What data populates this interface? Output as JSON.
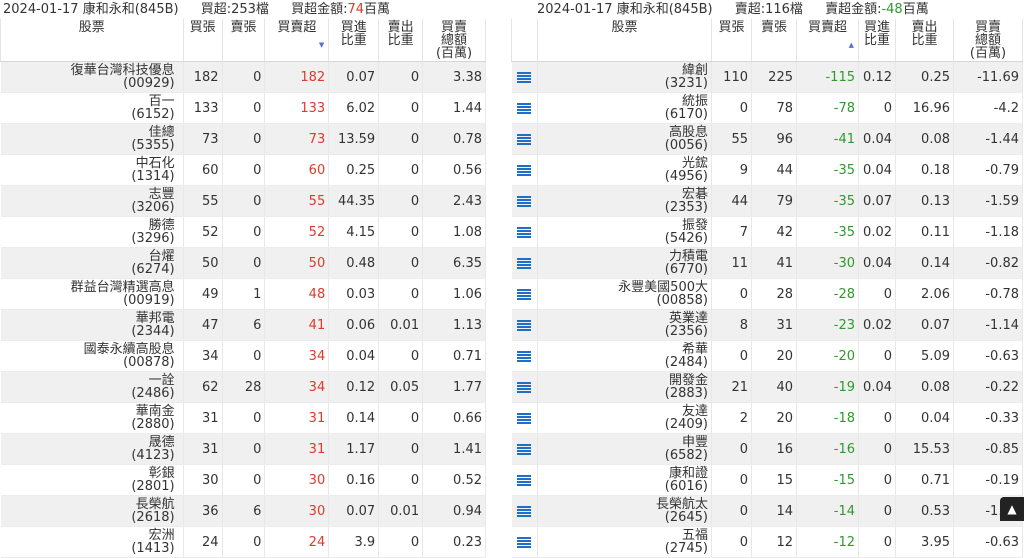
{
  "left": {
    "date": "2024-01-17",
    "broker": "康和永和(845B)",
    "stat_count_label": "買超:253檔",
    "stat_amount_prefix": "買超金額:",
    "stat_amount_value": "74",
    "stat_amount_unit": "百萬",
    "headers": {
      "stock": "股票",
      "buy": "買張",
      "sell": "賣張",
      "net": "買賣超",
      "buy_ratio_1": "買進",
      "buy_ratio_2": "比重",
      "sell_ratio_1": "賣出",
      "sell_ratio_2": "比重",
      "amount_1": "買賣",
      "amount_2": "總額",
      "amount_3": "(百萬)"
    },
    "rows": [
      {
        "name": "復華台灣科技優息",
        "code": "(00929)",
        "buy": "182",
        "sell": "0",
        "net": "182",
        "buy_ratio": "0.07",
        "sell_ratio": "0",
        "amount": "3.38"
      },
      {
        "name": "百一",
        "code": "(6152)",
        "buy": "133",
        "sell": "0",
        "net": "133",
        "buy_ratio": "6.02",
        "sell_ratio": "0",
        "amount": "1.44"
      },
      {
        "name": "佳總",
        "code": "(5355)",
        "buy": "73",
        "sell": "0",
        "net": "73",
        "buy_ratio": "13.59",
        "sell_ratio": "0",
        "amount": "0.78"
      },
      {
        "name": "中石化",
        "code": "(1314)",
        "buy": "60",
        "sell": "0",
        "net": "60",
        "buy_ratio": "0.25",
        "sell_ratio": "0",
        "amount": "0.56"
      },
      {
        "name": "志豐",
        "code": "(3206)",
        "buy": "55",
        "sell": "0",
        "net": "55",
        "buy_ratio": "44.35",
        "sell_ratio": "0",
        "amount": "2.43"
      },
      {
        "name": "勝德",
        "code": "(3296)",
        "buy": "52",
        "sell": "0",
        "net": "52",
        "buy_ratio": "4.15",
        "sell_ratio": "0",
        "amount": "1.08"
      },
      {
        "name": "台燿",
        "code": "(6274)",
        "buy": "50",
        "sell": "0",
        "net": "50",
        "buy_ratio": "0.48",
        "sell_ratio": "0",
        "amount": "6.35"
      },
      {
        "name": "群益台灣精選高息",
        "code": "(00919)",
        "buy": "49",
        "sell": "1",
        "net": "48",
        "buy_ratio": "0.03",
        "sell_ratio": "0",
        "amount": "1.06"
      },
      {
        "name": "華邦電",
        "code": "(2344)",
        "buy": "47",
        "sell": "6",
        "net": "41",
        "buy_ratio": "0.06",
        "sell_ratio": "0.01",
        "amount": "1.13"
      },
      {
        "name": "國泰永續高股息",
        "code": "(00878)",
        "buy": "34",
        "sell": "0",
        "net": "34",
        "buy_ratio": "0.04",
        "sell_ratio": "0",
        "amount": "0.71"
      },
      {
        "name": "一詮",
        "code": "(2486)",
        "buy": "62",
        "sell": "28",
        "net": "34",
        "buy_ratio": "0.12",
        "sell_ratio": "0.05",
        "amount": "1.77"
      },
      {
        "name": "華南金",
        "code": "(2880)",
        "buy": "31",
        "sell": "0",
        "net": "31",
        "buy_ratio": "0.14",
        "sell_ratio": "0",
        "amount": "0.66"
      },
      {
        "name": "晟德",
        "code": "(4123)",
        "buy": "31",
        "sell": "0",
        "net": "31",
        "buy_ratio": "1.17",
        "sell_ratio": "0",
        "amount": "1.41"
      },
      {
        "name": "彰銀",
        "code": "(2801)",
        "buy": "30",
        "sell": "0",
        "net": "30",
        "buy_ratio": "0.16",
        "sell_ratio": "0",
        "amount": "0.52"
      },
      {
        "name": "長榮航",
        "code": "(2618)",
        "buy": "36",
        "sell": "6",
        "net": "30",
        "buy_ratio": "0.07",
        "sell_ratio": "0.01",
        "amount": "0.94"
      },
      {
        "name": "宏洲",
        "code": "(1413)",
        "buy": "24",
        "sell": "0",
        "net": "24",
        "buy_ratio": "3.9",
        "sell_ratio": "0",
        "amount": "0.23"
      }
    ]
  },
  "right": {
    "date": "2024-01-17",
    "broker": "康和永和(845B)",
    "stat_count_label": "賣超:116檔",
    "stat_amount_prefix": "賣超金額:",
    "stat_amount_value": "-48",
    "stat_amount_unit": "百萬",
    "headers": {
      "stock": "股票",
      "buy": "買張",
      "sell": "賣張",
      "net": "買賣超",
      "buy_ratio_1": "買進",
      "buy_ratio_2": "比重",
      "sell_ratio_1": "賣出",
      "sell_ratio_2": "比重",
      "amount_1": "買賣",
      "amount_2": "總額",
      "amount_3": "(百萬)"
    },
    "rows": [
      {
        "name": "緯創",
        "code": "(3231)",
        "buy": "110",
        "sell": "225",
        "net": "-115",
        "buy_ratio": "0.12",
        "sell_ratio": "0.25",
        "amount": "-11.69"
      },
      {
        "name": "統振",
        "code": "(6170)",
        "buy": "0",
        "sell": "78",
        "net": "-78",
        "buy_ratio": "0",
        "sell_ratio": "16.96",
        "amount": "-4.2"
      },
      {
        "name": "高股息",
        "code": "(0056)",
        "buy": "55",
        "sell": "96",
        "net": "-41",
        "buy_ratio": "0.04",
        "sell_ratio": "0.08",
        "amount": "-1.44"
      },
      {
        "name": "光鋐",
        "code": "(4956)",
        "buy": "9",
        "sell": "44",
        "net": "-35",
        "buy_ratio": "0.04",
        "sell_ratio": "0.18",
        "amount": "-0.79"
      },
      {
        "name": "宏碁",
        "code": "(2353)",
        "buy": "44",
        "sell": "79",
        "net": "-35",
        "buy_ratio": "0.07",
        "sell_ratio": "0.13",
        "amount": "-1.59"
      },
      {
        "name": "振發",
        "code": "(5426)",
        "buy": "7",
        "sell": "42",
        "net": "-35",
        "buy_ratio": "0.02",
        "sell_ratio": "0.11",
        "amount": "-1.18"
      },
      {
        "name": "力積電",
        "code": "(6770)",
        "buy": "11",
        "sell": "41",
        "net": "-30",
        "buy_ratio": "0.04",
        "sell_ratio": "0.14",
        "amount": "-0.82"
      },
      {
        "name": "永豐美國500大",
        "code": "(00858)",
        "buy": "0",
        "sell": "28",
        "net": "-28",
        "buy_ratio": "0",
        "sell_ratio": "2.06",
        "amount": "-0.78"
      },
      {
        "name": "英業達",
        "code": "(2356)",
        "buy": "8",
        "sell": "31",
        "net": "-23",
        "buy_ratio": "0.02",
        "sell_ratio": "0.07",
        "amount": "-1.14"
      },
      {
        "name": "希華",
        "code": "(2484)",
        "buy": "0",
        "sell": "20",
        "net": "-20",
        "buy_ratio": "0",
        "sell_ratio": "5.09",
        "amount": "-0.63"
      },
      {
        "name": "開發金",
        "code": "(2883)",
        "buy": "21",
        "sell": "40",
        "net": "-19",
        "buy_ratio": "0.04",
        "sell_ratio": "0.08",
        "amount": "-0.22"
      },
      {
        "name": "友達",
        "code": "(2409)",
        "buy": "2",
        "sell": "20",
        "net": "-18",
        "buy_ratio": "0",
        "sell_ratio": "0.04",
        "amount": "-0.33"
      },
      {
        "name": "申豐",
        "code": "(6582)",
        "buy": "0",
        "sell": "16",
        "net": "-16",
        "buy_ratio": "0",
        "sell_ratio": "15.53",
        "amount": "-0.85"
      },
      {
        "name": "康和證",
        "code": "(6016)",
        "buy": "0",
        "sell": "15",
        "net": "-15",
        "buy_ratio": "0",
        "sell_ratio": "0.71",
        "amount": "-0.19"
      },
      {
        "name": "長榮航太",
        "code": "(2645)",
        "buy": "0",
        "sell": "14",
        "net": "-14",
        "buy_ratio": "0",
        "sell_ratio": "0.53",
        "amount": "-1.41"
      },
      {
        "name": "五福",
        "code": "(2745)",
        "buy": "0",
        "sell": "12",
        "net": "-12",
        "buy_ratio": "0",
        "sell_ratio": "3.95",
        "amount": "-0.63"
      }
    ]
  },
  "icons": {
    "row_icon": "list-icon",
    "scroll_top": "chevron-up-icon"
  },
  "colors": {
    "buy": "#e0392b",
    "sell": "#2e9a2e",
    "row_icon": "#1f6fc9",
    "alt_row": "#f0f0f0"
  }
}
